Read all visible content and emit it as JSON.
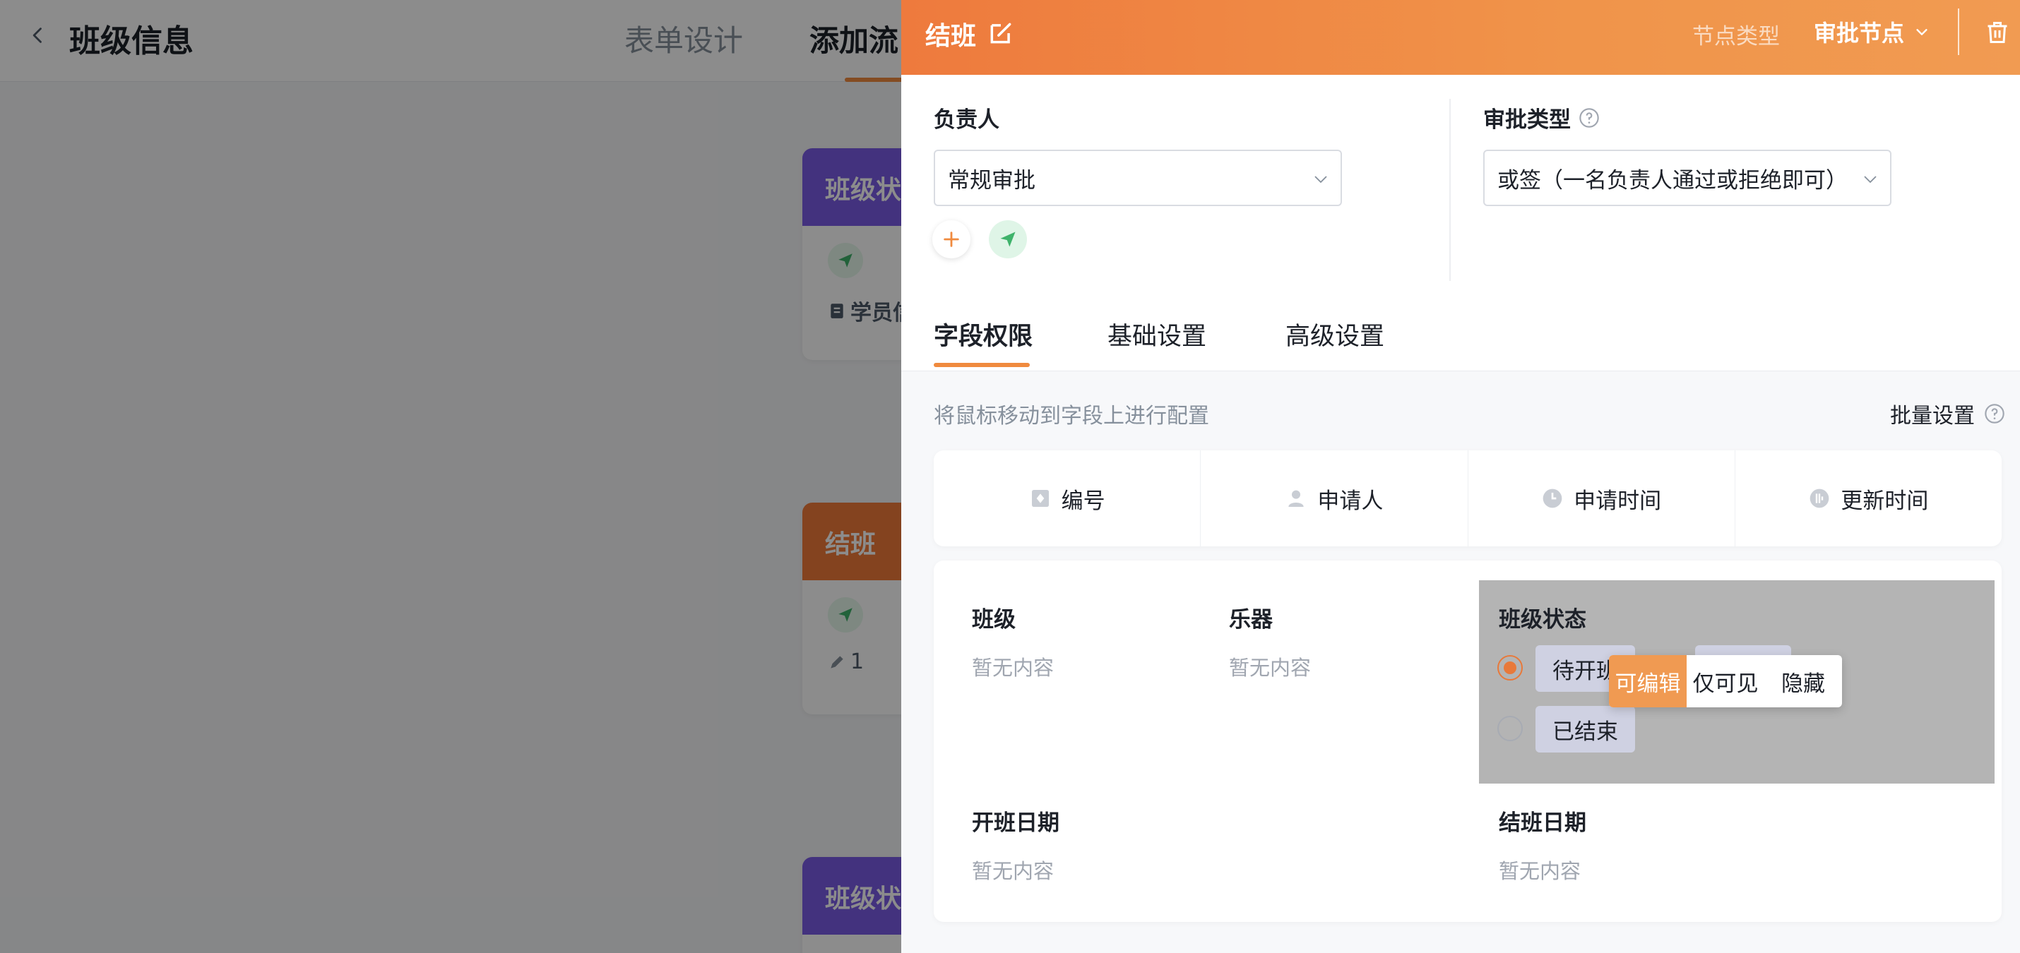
{
  "background": {
    "title": "班级信息",
    "tabs": [
      "表单设计",
      "添加流"
    ],
    "cards": [
      {
        "title": "班级状",
        "text": "学员信"
      },
      {
        "title": "结班",
        "text": "1"
      },
      {
        "title": "班级状"
      }
    ]
  },
  "drawer": {
    "title": "结班",
    "node_type_label": "节点类型",
    "node_type_value": "审批节点",
    "assignee": {
      "label": "负责人",
      "select_value": "常规审批"
    },
    "approval_type": {
      "label": "审批类型",
      "select_value": "或签（一名负责人通过或拒绝即可）"
    },
    "tabs": [
      {
        "label": "字段权限",
        "active": true
      },
      {
        "label": "基础设置",
        "active": false
      },
      {
        "label": "高级设置",
        "active": false
      }
    ],
    "hint": "将鼠标移动到字段上进行配置",
    "batch_label": "批量设置",
    "system_fields": [
      {
        "label": "编号",
        "icon": "id-card-icon"
      },
      {
        "label": "申请人",
        "icon": "user-icon"
      },
      {
        "label": "申请时间",
        "icon": "clock-icon"
      },
      {
        "label": "更新时间",
        "icon": "refresh-time-icon"
      }
    ],
    "form_fields": {
      "class": {
        "label": "班级",
        "empty": "暂无内容"
      },
      "instrument": {
        "label": "乐器",
        "empty": "暂无内容"
      },
      "class_status": {
        "label": "班级状态",
        "options": [
          "待开班",
          "",
          "已结束"
        ]
      },
      "start_date": {
        "label": "开班日期",
        "empty": "暂无内容"
      },
      "end_date": {
        "label": "结班日期",
        "empty": "暂无内容"
      }
    },
    "permission_menu": [
      "可编辑",
      "仅可见",
      "隐藏"
    ],
    "colors": {
      "accent": "#f08a3e",
      "header_start": "#ee7a3d",
      "header_end": "#f19b52",
      "send_green": "#3fb36b",
      "chip_bg": "#cfd1e2"
    }
  }
}
